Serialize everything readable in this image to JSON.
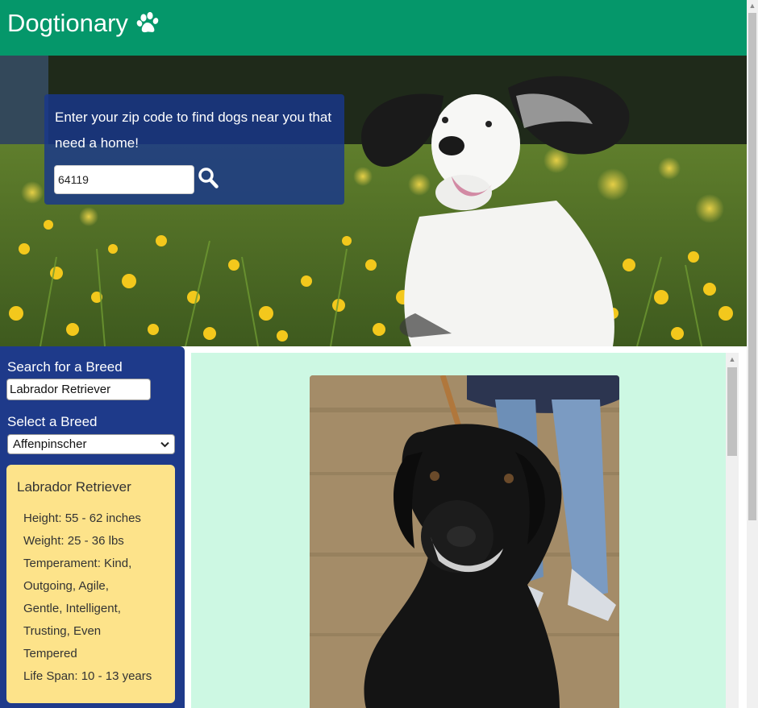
{
  "app": {
    "title": "Dogtionary"
  },
  "hero": {
    "zip_prompt": "Enter your zip code to find dogs near you that need a home!",
    "zip_value": "64119"
  },
  "sidebar": {
    "search_label": "Search for a Breed",
    "search_value": "Labrador Retriever",
    "select_label": "Select a Breed",
    "select_value": "Affenpinscher"
  },
  "breed_info": {
    "name": "Labrador Retriever",
    "height": "Height: 55 - 62 inches",
    "weight": "Weight: 25 - 36 lbs",
    "temperament_line1": "Temperament: Kind,",
    "temperament_line2": "Outgoing, Agile,",
    "temperament_line3": "Gentle, Intelligent,",
    "temperament_line4": "Trusting, Even",
    "temperament_line5": "Tempered",
    "life_span": "Life Span: 10 - 13 years"
  },
  "colors": {
    "header_bg": "#05976a",
    "sidebar_bg": "#1e3a8a",
    "info_card_bg": "#fde38a",
    "main_bg": "#cdf8e3",
    "zip_card_bg": "#19378c"
  },
  "icons": {
    "brand": "paw-icon",
    "search": "search-icon",
    "select": "chevron-down-icon"
  }
}
